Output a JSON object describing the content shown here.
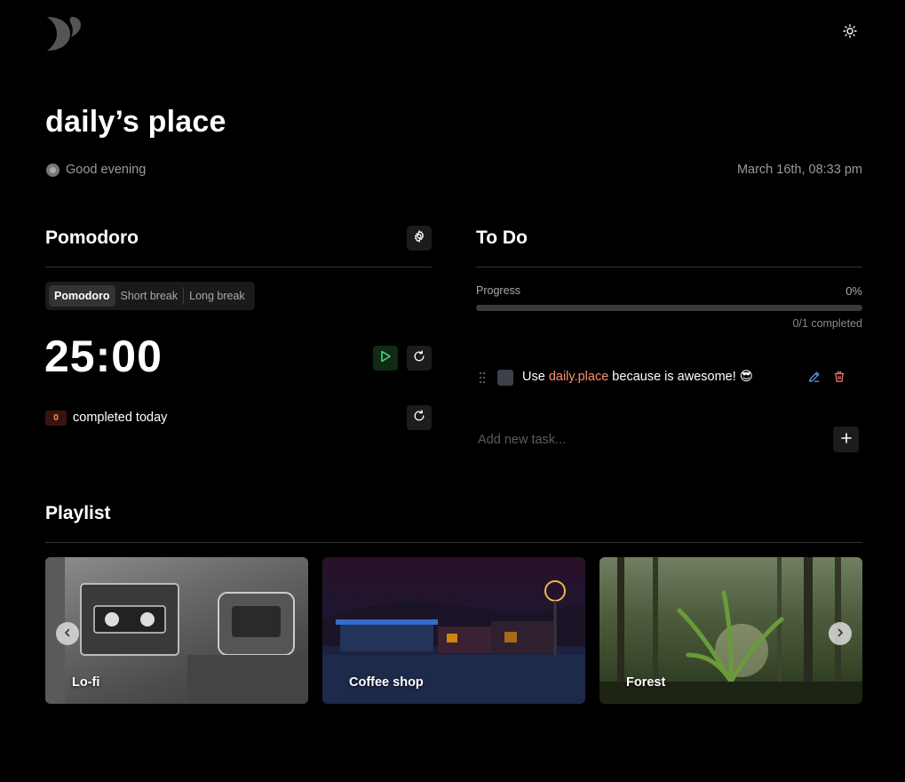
{
  "header": {
    "logo_icon": "moon-logo-icon",
    "theme_toggle_icon": "sun-icon"
  },
  "page": {
    "title": "daily’s place",
    "greeting": "Good evening",
    "datetime": "March 16th, 08:33 pm"
  },
  "pomodoro": {
    "title": "Pomodoro",
    "settings_icon": "gear-icon",
    "tabs": [
      {
        "label": "Pomodoro",
        "active": true
      },
      {
        "label": "Short break",
        "active": false
      },
      {
        "label": "Long break",
        "active": false
      }
    ],
    "timer": "25:00",
    "completed_count": "0",
    "completed_label": "completed today"
  },
  "todo": {
    "title": "To Do",
    "progress_label": "Progress",
    "progress_percent": "0%",
    "progress_value": 0,
    "completed_text": "0/1 completed",
    "tasks": [
      {
        "prefix": "Use ",
        "link": "daily.place",
        "suffix": " because is awesome! 😎",
        "done": false
      }
    ],
    "add_placeholder": "Add new task..."
  },
  "playlist": {
    "title": "Playlist",
    "items": [
      {
        "label": "Lo-fi"
      },
      {
        "label": "Coffee shop"
      },
      {
        "label": "Forest"
      }
    ]
  },
  "colors": {
    "accent": "#ff8f6a",
    "background": "#000000",
    "play_button_bg": "#112a14"
  }
}
